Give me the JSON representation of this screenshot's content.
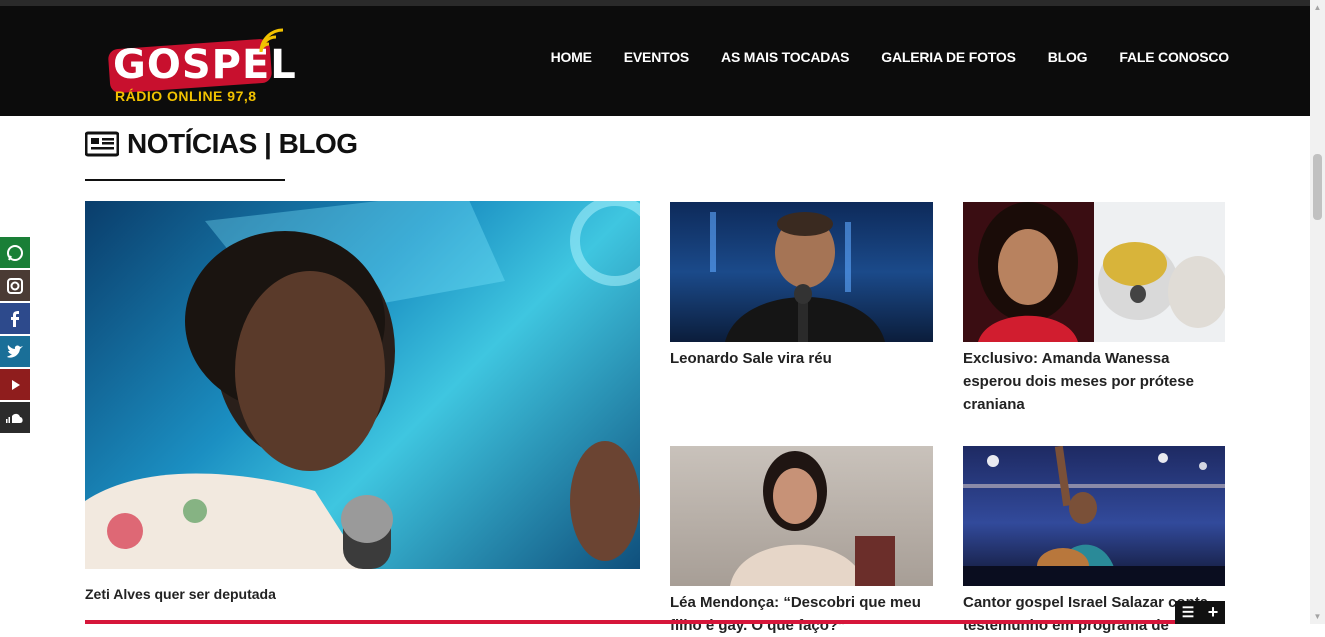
{
  "brand": {
    "logo_word": "GOSPEL",
    "logo_sub": "RÁDIO ONLINE 97,8",
    "accent": "#c8102e",
    "gold": "#f2c200"
  },
  "nav": {
    "items": [
      "HOME",
      "EVENTOS",
      "AS MAIS TOCADAS",
      "GALERIA DE FOTOS",
      "BLOG",
      "FALE CONOSCO"
    ]
  },
  "section": {
    "title": "NOTÍCIAS | BLOG",
    "icon": "newspaper-icon"
  },
  "social": [
    {
      "icon": "whatsapp-icon",
      "color": "#1a7f37"
    },
    {
      "icon": "instagram-icon",
      "color": "#4a3b34"
    },
    {
      "icon": "facebook-icon",
      "color": "#2d4a8c"
    },
    {
      "icon": "twitter-icon",
      "color": "#1a6f98"
    },
    {
      "icon": "youtube-icon",
      "color": "#8f1d1d"
    },
    {
      "icon": "soundcloud-icon",
      "color": "#2b2b2b"
    }
  ],
  "posts": {
    "featured": {
      "title": "Zeti Alves quer ser deputada"
    },
    "p1": {
      "title": "Leonardo Sale vira réu"
    },
    "p2": {
      "title": "Exclusivo: Amanda Wanessa esperou dois meses por prótese craniana"
    },
    "p3": {
      "title": "Léa Mendonça: “Descobri que meu filho é gay. O que faço?”"
    },
    "p4": {
      "title": "Cantor gospel Israel Salazar conta testemunho em programa de"
    }
  },
  "footer_bar": {
    "color": "#d6163a",
    "menu_icon": "list-icon",
    "plus": "+"
  }
}
